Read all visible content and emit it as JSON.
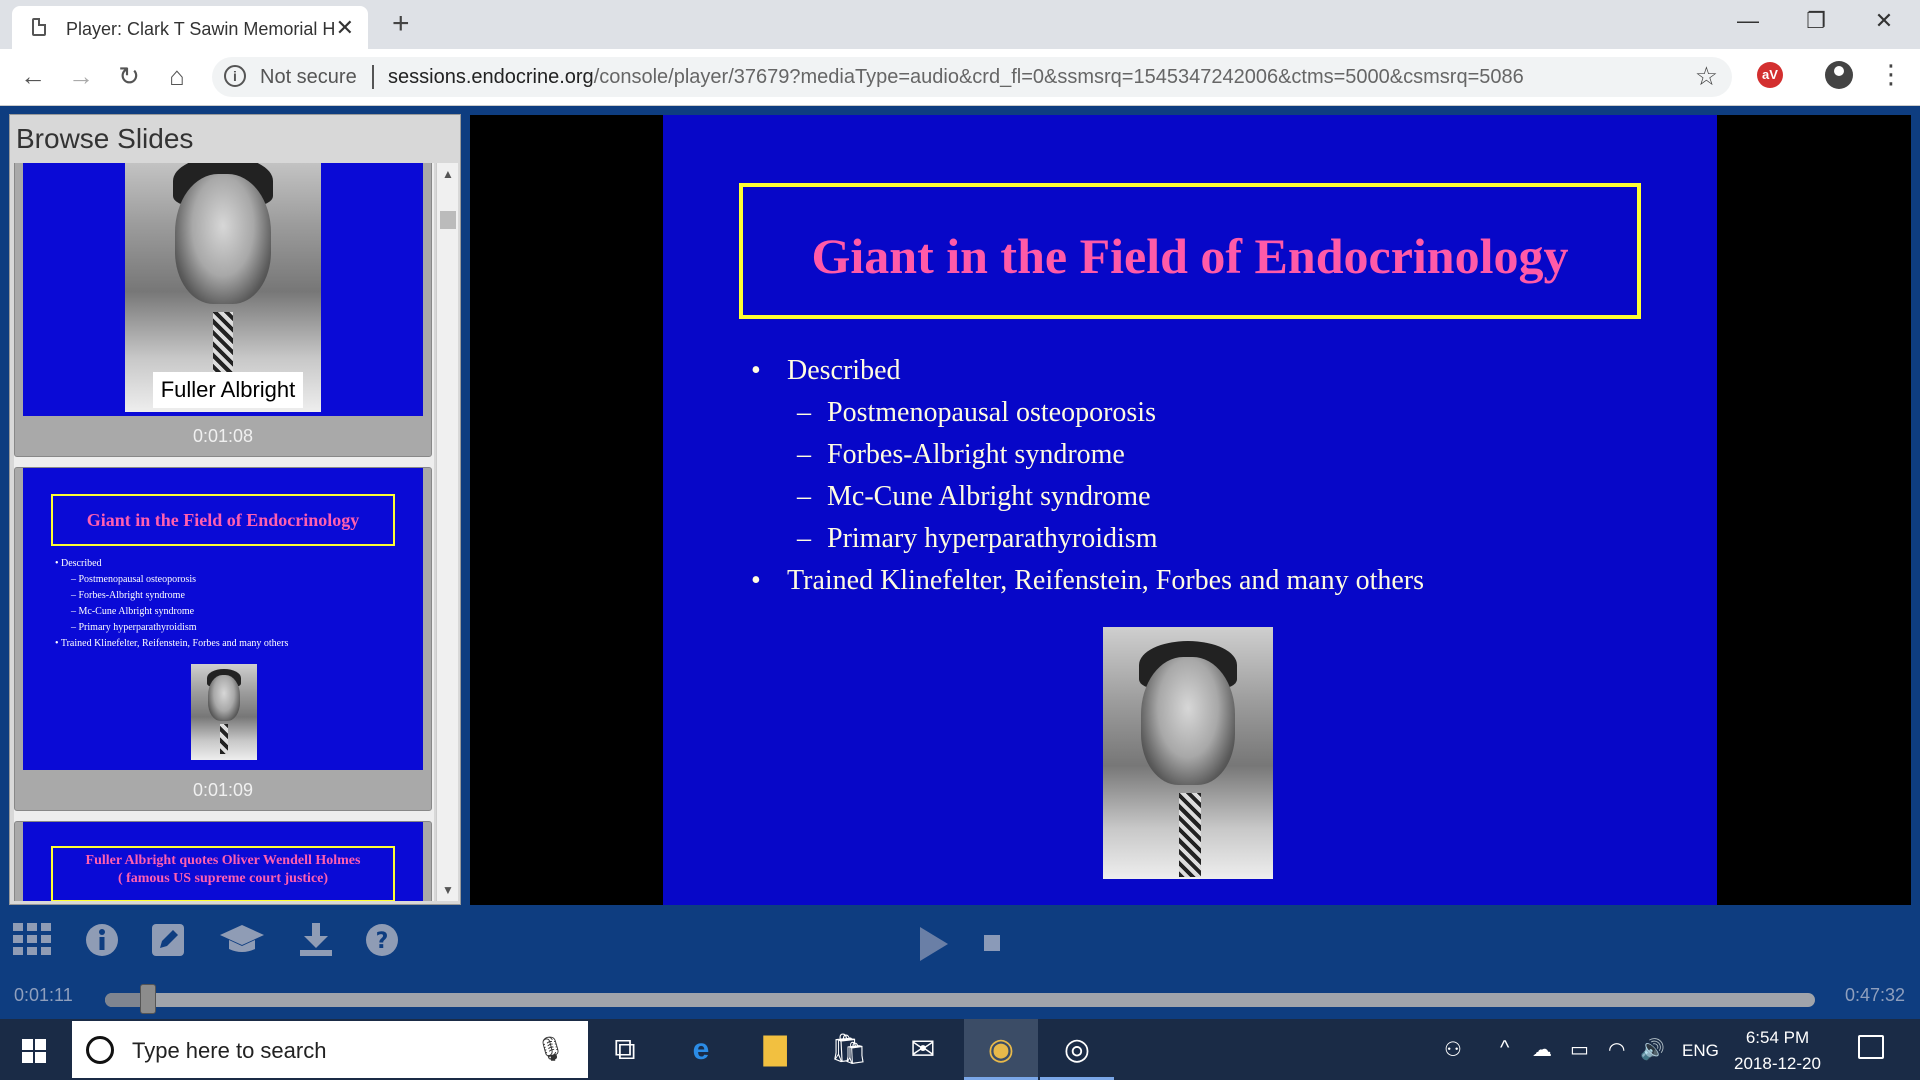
{
  "browser": {
    "tab_title": "Player: Clark T Sawin Memorial H",
    "tab_close": "✕",
    "new_tab": "+",
    "minimize": "—",
    "restore": "❐",
    "close": "✕",
    "back": "←",
    "forward": "→",
    "reload": "↻",
    "home": "⌂",
    "info_icon": "i",
    "security_label": "Not secure",
    "url_host": "sessions.endocrine.org",
    "url_path": "/console/player/37679?mediaType=audio&crd_fl=0&ssmsrq=1545347242006&ctms=5000&csmsrq=5086",
    "star": "☆",
    "ext_label": "aV",
    "menu": "⋮"
  },
  "browse": {
    "title": "Browse Slides",
    "scroll_up": "▲",
    "scroll_down": "▼",
    "thumbs": [
      {
        "caption": "Fuller Albright",
        "time": "0:01:08"
      },
      {
        "title": "Giant in the Field of Endocrinology",
        "bullets": [
          "• Described",
          "– Postmenopausal osteoporosis",
          "– Forbes-Albright syndrome",
          "– Mc-Cune Albright syndrome",
          "– Primary hyperparathyroidism",
          "• Trained Klinefelter, Reifenstein, Forbes and many others"
        ],
        "time": "0:01:09"
      },
      {
        "title_line1": "Fuller Albright quotes Oliver Wendell Holmes",
        "title_line2": "( famous US supreme court justice)"
      }
    ]
  },
  "slide": {
    "title": "Giant in the Field of Endocrinology",
    "bullet": "•",
    "dash": "–",
    "described": "Described",
    "items": [
      "Postmenopausal osteoporosis",
      "Forbes-Albright syndrome",
      "Mc-Cune Albright syndrome",
      "Primary hyperparathyroidism"
    ],
    "trained": "Trained Klinefelter, Reifenstein, Forbes and many others"
  },
  "controls": {
    "icons": [
      "grid-icon",
      "info-icon",
      "edit-icon",
      "graduation-cap-icon",
      "download-icon",
      "help-icon"
    ],
    "time_current": "0:01:11",
    "time_total": "0:47:32",
    "progress_fraction": 0.025
  },
  "taskbar": {
    "search_placeholder": "Type here to search",
    "mic": "🎙",
    "task_view": "⧉",
    "edge": "e",
    "explorer": "▇",
    "store": "🛍",
    "mail": "✉",
    "chrome": "◉",
    "groove": "◎",
    "people": "⚇",
    "tray_up": "^",
    "cloud": "☁",
    "battery": "▭",
    "wifi": "◠",
    "volume": "🔊",
    "lang": "ENG",
    "time": "6:54 PM",
    "date": "2018-12-20"
  }
}
